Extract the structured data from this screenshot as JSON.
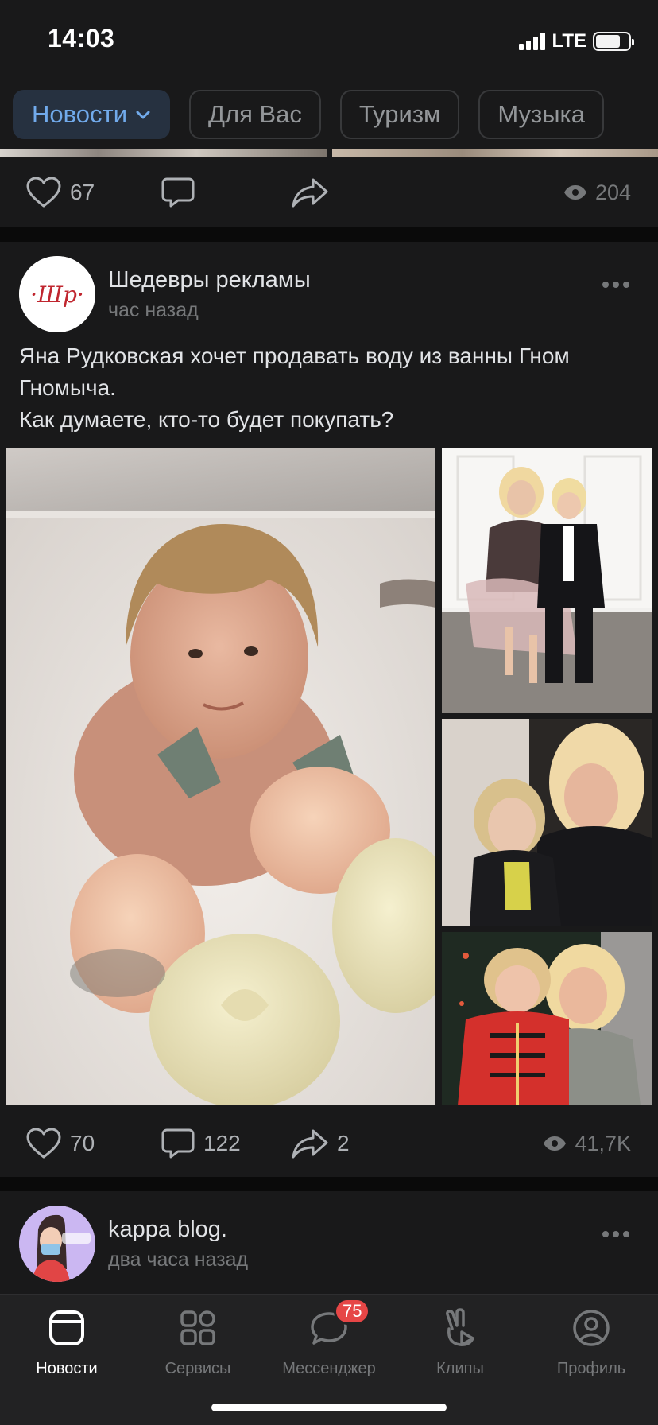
{
  "status_bar": {
    "time": "14:03",
    "network": "LTE"
  },
  "tabs": [
    {
      "label": "Новости",
      "active": true
    },
    {
      "label": "Для Вас",
      "active": false
    },
    {
      "label": "Туризм",
      "active": false
    },
    {
      "label": "Музыка",
      "active": false
    }
  ],
  "prev_post": {
    "likes": "67",
    "views": "204"
  },
  "post": {
    "author": "Шедевры рекламы",
    "avatar_text": "·Шр·",
    "time": "час назад",
    "text_line1": "Яна Рудковская хочет продавать воду из ванны Гном",
    "text_line2": "Гномыча.",
    "text_line3": "Как думаете, кто-то будет покупать?",
    "likes": "70",
    "comments": "122",
    "shares": "2",
    "views": "41,7K"
  },
  "next_post": {
    "author": "kappa blog.",
    "time": "два часа назад"
  },
  "bottom_nav": [
    {
      "label": "Новости",
      "icon": "news-icon",
      "active": true
    },
    {
      "label": "Сервисы",
      "icon": "services-icon",
      "active": false
    },
    {
      "label": "Мессенджер",
      "icon": "messenger-icon",
      "active": false,
      "badge": "75"
    },
    {
      "label": "Клипы",
      "icon": "clips-icon",
      "active": false
    },
    {
      "label": "Профиль",
      "icon": "profile-icon",
      "active": false
    }
  ],
  "colors": {
    "accent": "#71aaeb",
    "background": "#19191a",
    "badge": "#e64646"
  }
}
